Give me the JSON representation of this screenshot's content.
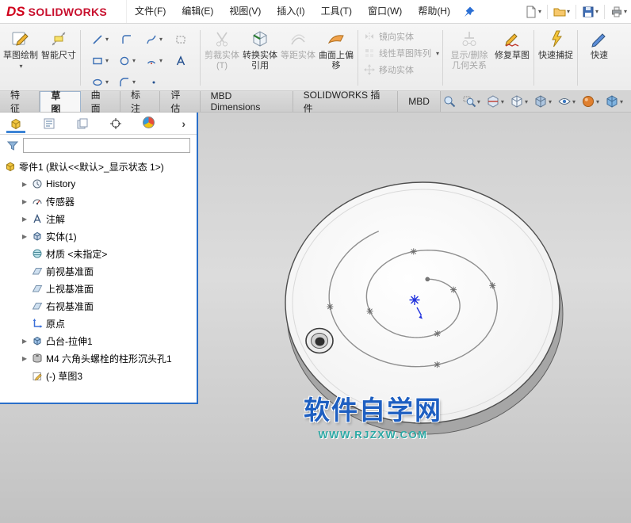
{
  "brand": {
    "ds": "DS",
    "name": "SOLIDWORKS"
  },
  "menubar": {
    "items": [
      "文件(F)",
      "编辑(E)",
      "视图(V)",
      "插入(I)",
      "工具(T)",
      "窗口(W)",
      "帮助(H)"
    ]
  },
  "quick_access_icons": [
    "new-document-icon",
    "open-icon",
    "save-icon",
    "print-icon"
  ],
  "ribbon": {
    "sketch": "草图绘制",
    "smart_dimension": "智能尺寸",
    "trim": "剪裁实体(T)",
    "convert": "转换实体引用",
    "offset": "等距实体",
    "surface_offset": "曲面上偏移",
    "mirror": "镜向实体",
    "linear_pattern": "线性草图阵列",
    "move": "移动实体",
    "display_relations": "显示/删除几何关系",
    "repair": "修复草图",
    "quick_snaps": "快速捕捉",
    "quick_cut": "快速"
  },
  "tabs": {
    "items": [
      "特征",
      "草图",
      "曲面",
      "标注",
      "评估",
      "MBD Dimensions",
      "SOLIDWORKS 插件",
      "MBD"
    ],
    "active": "草图"
  },
  "headsup_icons": [
    "zoom-fit-icon",
    "zoom-area-icon",
    "section-view-icon",
    "view-orientation-icon",
    "display-style-icon",
    "hide-show-icon",
    "appearance-icon",
    "scene-icon"
  ],
  "tree": {
    "root": "零件1 (默认<<默认>_显示状态 1>)",
    "items": [
      {
        "label": "History",
        "icon": "history-icon"
      },
      {
        "label": "传感器",
        "icon": "sensors-icon"
      },
      {
        "label": "注解",
        "icon": "annotations-icon"
      },
      {
        "label": "实体(1)",
        "icon": "solid-bodies-icon"
      },
      {
        "label": "材质 <未指定>",
        "icon": "material-icon"
      },
      {
        "label": "前视基准面",
        "icon": "plane-icon"
      },
      {
        "label": "上视基准面",
        "icon": "plane-icon"
      },
      {
        "label": "右视基准面",
        "icon": "plane-icon"
      },
      {
        "label": "原点",
        "icon": "origin-icon"
      },
      {
        "label": "凸台-拉伸1",
        "icon": "boss-extrude-icon"
      },
      {
        "label": "M4 六角头螺栓的柱形沉头孔1",
        "icon": "hole-wizard-icon"
      },
      {
        "label": "(-) 草图3",
        "icon": "sketch-icon"
      }
    ]
  },
  "viewport": {
    "watermark_title": "软件自学网",
    "watermark_url": "WWW.RJZXW.COM"
  },
  "colors": {
    "brand_red": "#c8102e",
    "panel_accent_blue": "#2a6fc9",
    "watermark_blue": "#1e5fc1",
    "watermark_teal": "#2ba8a4"
  }
}
